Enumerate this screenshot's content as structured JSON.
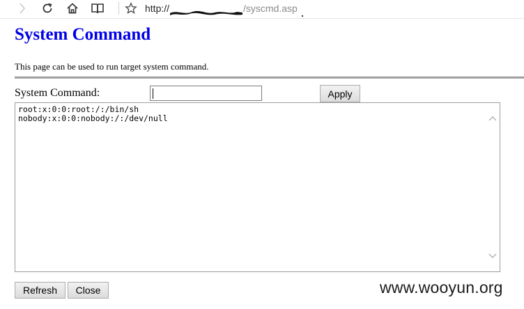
{
  "browser": {
    "url_scheme": "http://",
    "url_path": "/syscmd.asp"
  },
  "page": {
    "title": "System Command",
    "description": "This page can be used to run target system command."
  },
  "form": {
    "command_label": "System Command:",
    "command_value": "",
    "apply_label": "Apply",
    "output_lines": [
      "root:x:0:0:root:/:/bin/sh",
      "nobody:x:0:0:nobody:/:/dev/null"
    ],
    "refresh_label": "Refresh",
    "close_label": "Close"
  },
  "watermark": "www.wooyun.org",
  "colors": {
    "title": "#0000e6",
    "divider": "#a8a8a8"
  },
  "icons": [
    "forward-icon",
    "refresh-icon",
    "home-icon",
    "reading-view-icon",
    "favorite-star-icon",
    "scroll-up-icon",
    "scroll-down-icon"
  ]
}
